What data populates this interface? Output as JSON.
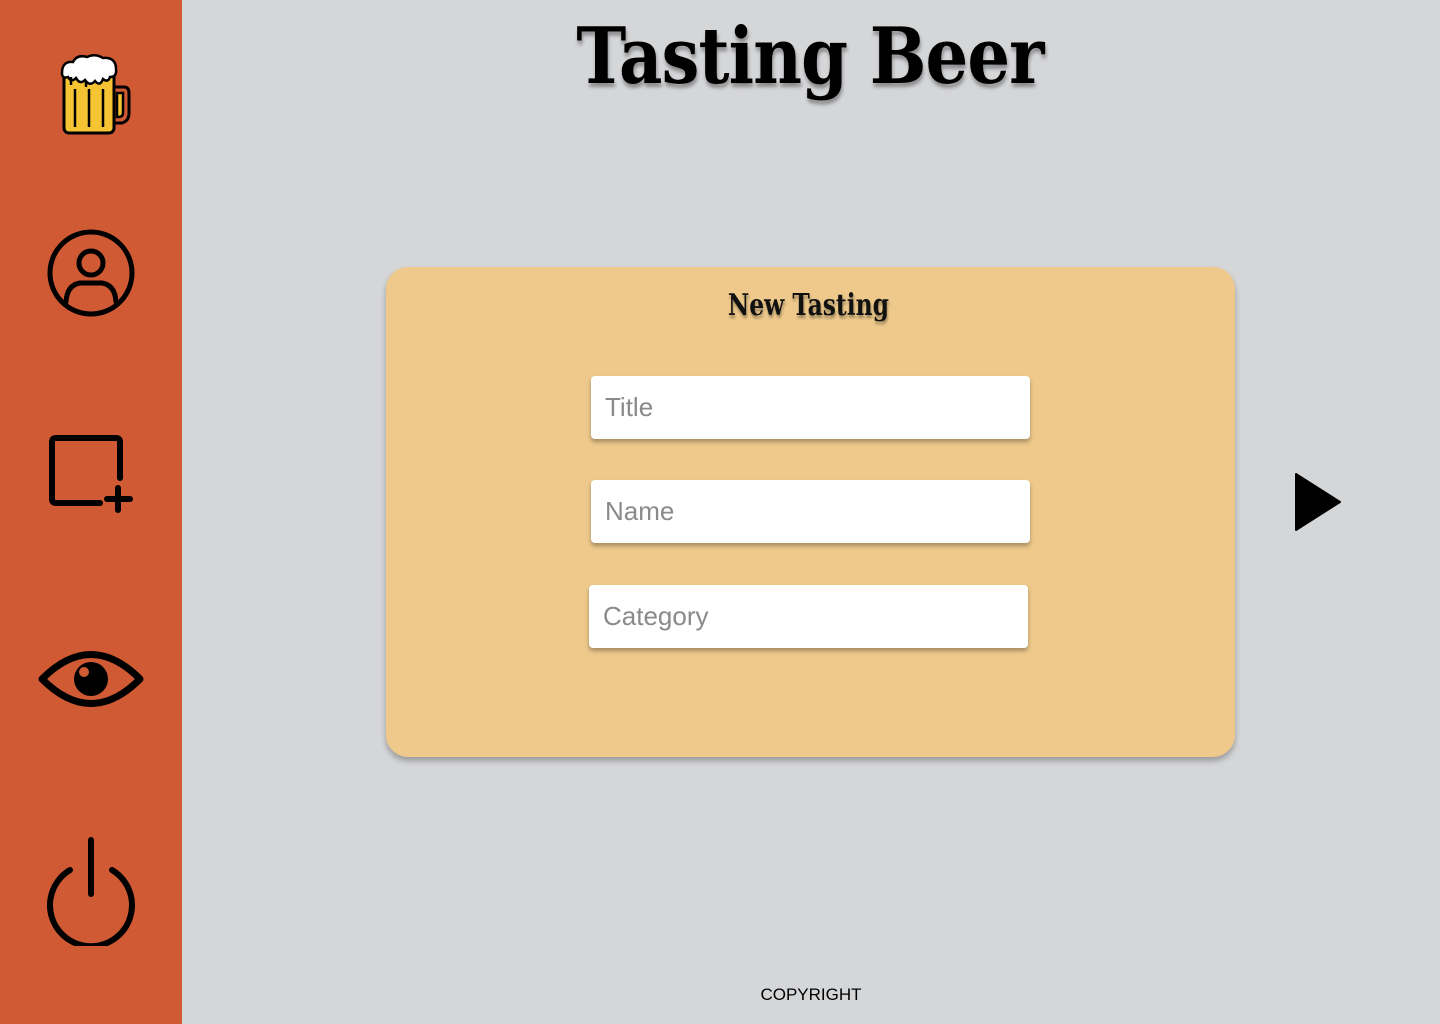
{
  "app": {
    "title": "Tasting Beer"
  },
  "sidebar": {
    "items": [
      {
        "icon": "beer-mug-icon",
        "role": "logo"
      },
      {
        "icon": "user-profile-icon",
        "role": "profile"
      },
      {
        "icon": "add-square-icon",
        "role": "add-tasting"
      },
      {
        "icon": "eye-icon",
        "role": "view-tastings"
      },
      {
        "icon": "power-icon",
        "role": "logout"
      }
    ]
  },
  "card": {
    "title": "New Tasting",
    "fields": {
      "title": {
        "value": "",
        "placeholder": "Title"
      },
      "name": {
        "value": "",
        "placeholder": "Name"
      },
      "category": {
        "value": "",
        "placeholder": "Category"
      }
    }
  },
  "navigation": {
    "next_icon": "play-arrow-right-icon"
  },
  "footer": {
    "copyright": "COPYRIGHT"
  },
  "colors": {
    "sidebar": "#d05a34",
    "background": "#d5d6d8",
    "card": "#eec98b",
    "input": "#ffffff",
    "beer": "#f6c433",
    "foam": "#ffffff",
    "icon_stroke": "#000000"
  }
}
